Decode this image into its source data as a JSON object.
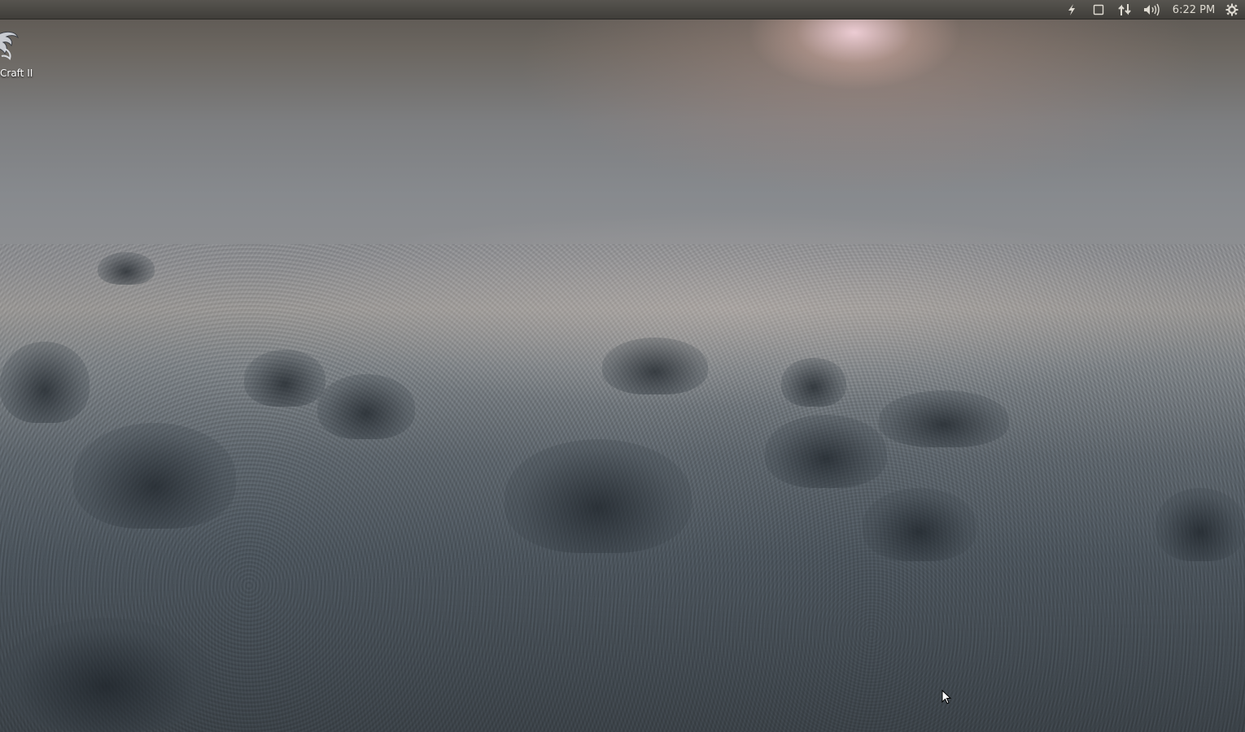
{
  "wallpaper": {
    "description_colors": {
      "sky_glow": "#f3d4dc",
      "field": "#878a8e",
      "frost_ground": "#4d565e"
    }
  },
  "top_panel": {
    "indicators": [
      {
        "name": "power-icon",
        "glyph": "⚡"
      },
      {
        "name": "keyboard-icon",
        "glyph": "□"
      },
      {
        "name": "network-icon",
        "glyph": "⇅"
      },
      {
        "name": "volume-icon",
        "glyph": "🔊"
      }
    ],
    "clock": "6:22 PM",
    "session_icon": "gear-icon",
    "colors": {
      "panel_top": "#57544f",
      "panel_bottom": "#403e3a",
      "text": "#dfdbd2"
    }
  },
  "desktop_icons": [
    {
      "label": "Craft II",
      "icon": "starcraft-logo-icon"
    }
  ]
}
